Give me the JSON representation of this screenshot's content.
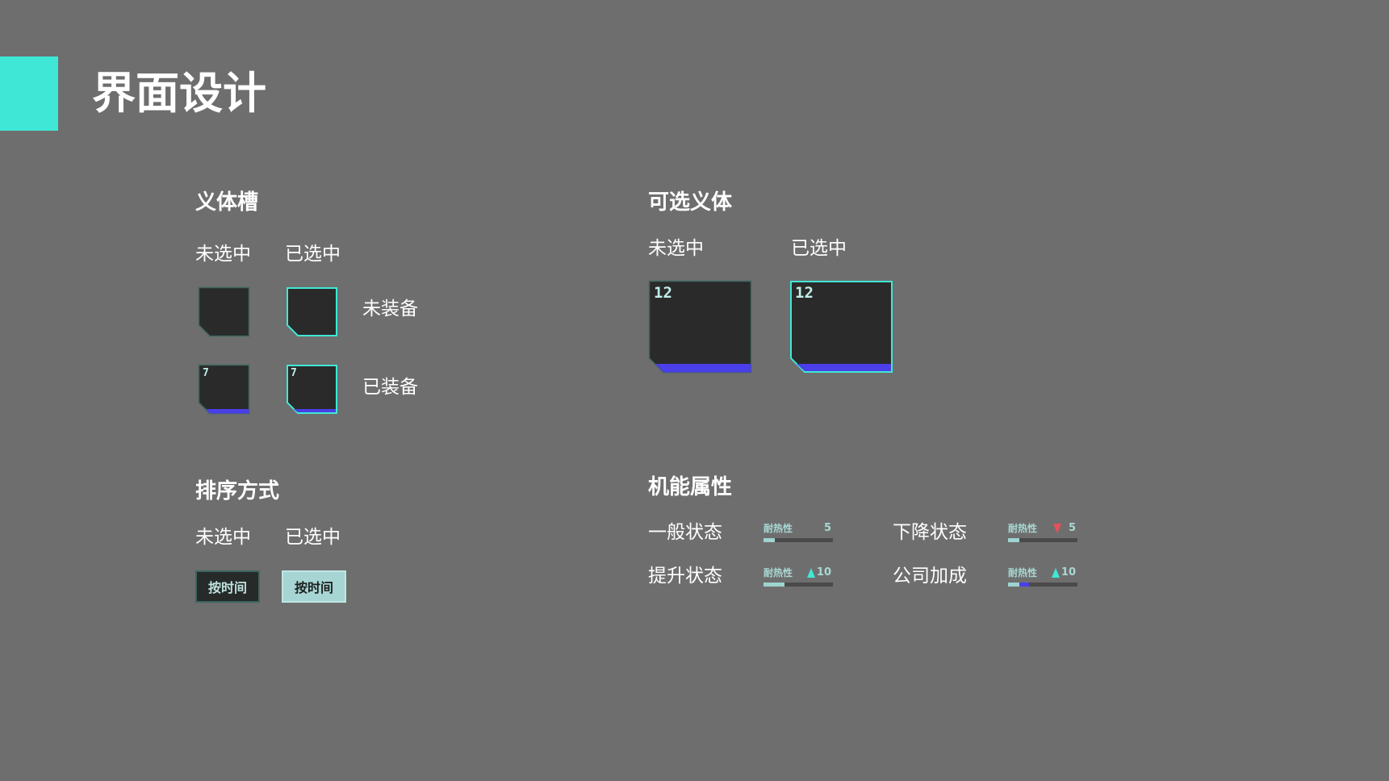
{
  "page_title": "界面设计",
  "colors": {
    "background": "#6e6e6e",
    "accent": "#3fe8d6",
    "slot_fill": "#2a2a2a",
    "slot_border_unselected": "#3d6660",
    "slot_border_selected": "#3fe8d6",
    "equipped_bar": "#4a3fe8",
    "decrease_arrow": "#e8505a"
  },
  "implant_slot": {
    "title": "义体槽",
    "col_unselected": "未选中",
    "col_selected": "已选中",
    "row_unequipped": "未装备",
    "row_equipped": "已装备",
    "equipped_number": "7"
  },
  "selectable_implants": {
    "title": "可选义体",
    "col_unselected": "未选中",
    "col_selected": "已选中",
    "number": "12"
  },
  "sort_method": {
    "title": "排序方式",
    "col_unselected": "未选中",
    "col_selected": "已选中",
    "button_label": "按时间"
  },
  "function_attributes": {
    "title": "机能属性",
    "items": [
      {
        "state": "一般状态",
        "attr": "耐热性",
        "value": "5",
        "trend": "none",
        "level": 0.16,
        "bonus": 0
      },
      {
        "state": "下降状态",
        "attr": "耐热性",
        "value": "5",
        "trend": "down",
        "level": 0.16,
        "bonus": 0
      },
      {
        "state": "提升状态",
        "attr": "耐热性",
        "value": "10",
        "trend": "up",
        "level": 0.3,
        "bonus": 0
      },
      {
        "state": "公司加成",
        "attr": "耐热性",
        "value": "10",
        "trend": "up",
        "level": 0.16,
        "bonus": 0.14
      }
    ]
  }
}
